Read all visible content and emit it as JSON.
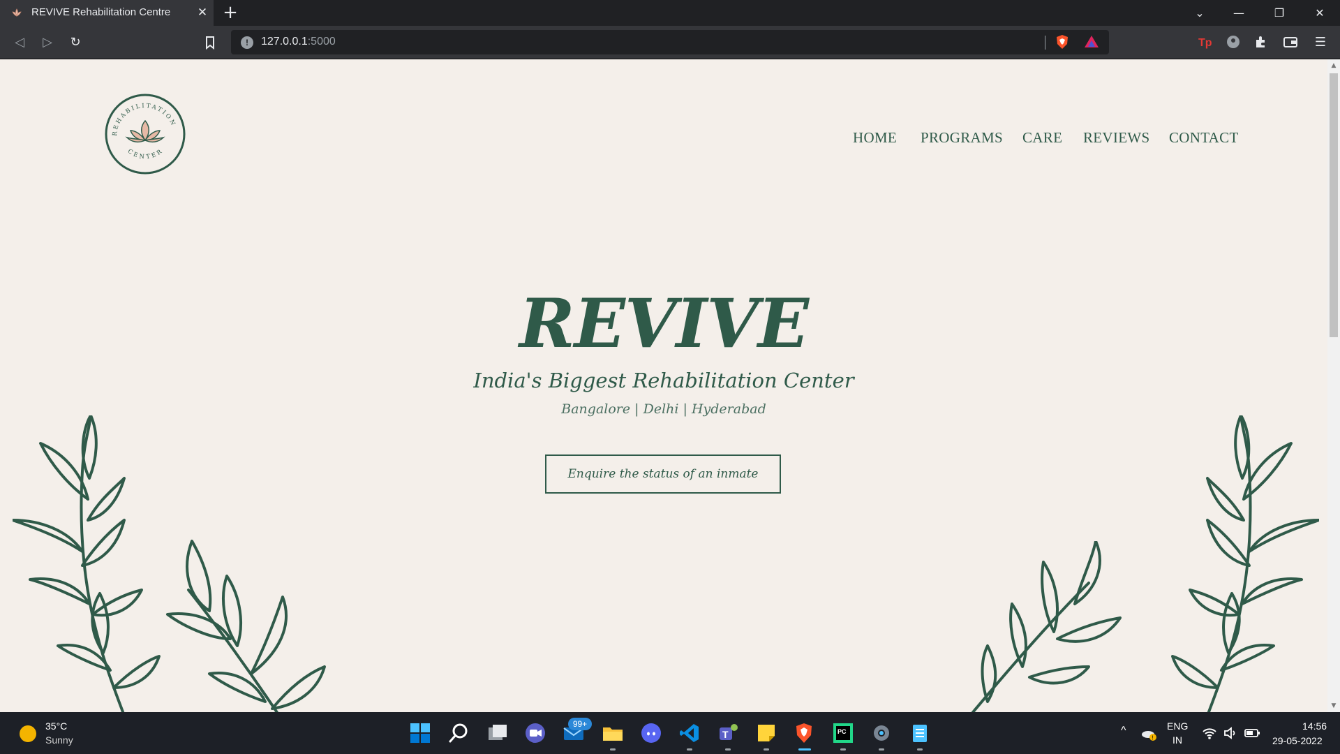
{
  "browser": {
    "tab_title": "REVIVE Rehabilitation Centre",
    "tab_close": "✕",
    "new_tab": "+",
    "url_host": "127.0.0.1",
    "url_port": ":5000"
  },
  "site": {
    "nav": [
      "HOME",
      "PROGRAMS",
      "CARE",
      "REVIEWS",
      "CONTACT"
    ],
    "hero_title": "REVIVE",
    "hero_subtitle": "India's Biggest Rehabilitation Center",
    "hero_cities": "Bangalore | Delhi | Hyderabad",
    "cta_label": "Enquire the status of an inmate",
    "logo_text_top": "REHABILITATION",
    "logo_text_bottom": "CENTER"
  },
  "taskbar": {
    "weather_temp": "35°C",
    "weather_condition": "Sunny",
    "mail_badge": "99+",
    "lang_primary": "ENG",
    "lang_secondary": "IN",
    "time": "14:56",
    "date": "29-05-2022"
  },
  "colors": {
    "page_bg": "#f4efea",
    "brand_green": "#2f5a49",
    "lotus_pink": "#e7b9a6"
  }
}
